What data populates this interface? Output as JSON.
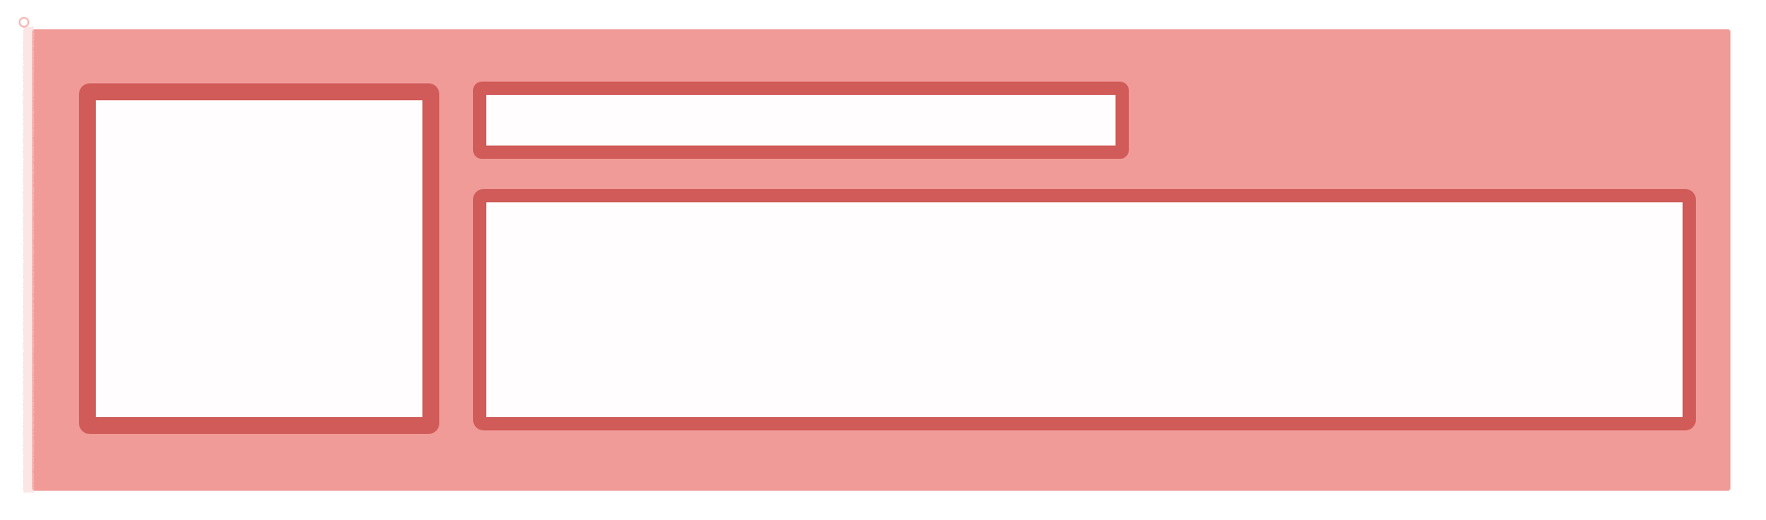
{
  "colors": {
    "card_fill": "#f19b98",
    "outline": "#d05b58",
    "box_fill": "#fffdfd",
    "background": "#ffffff"
  },
  "placeholders": {
    "thumbnail": "",
    "title": "",
    "content": ""
  }
}
